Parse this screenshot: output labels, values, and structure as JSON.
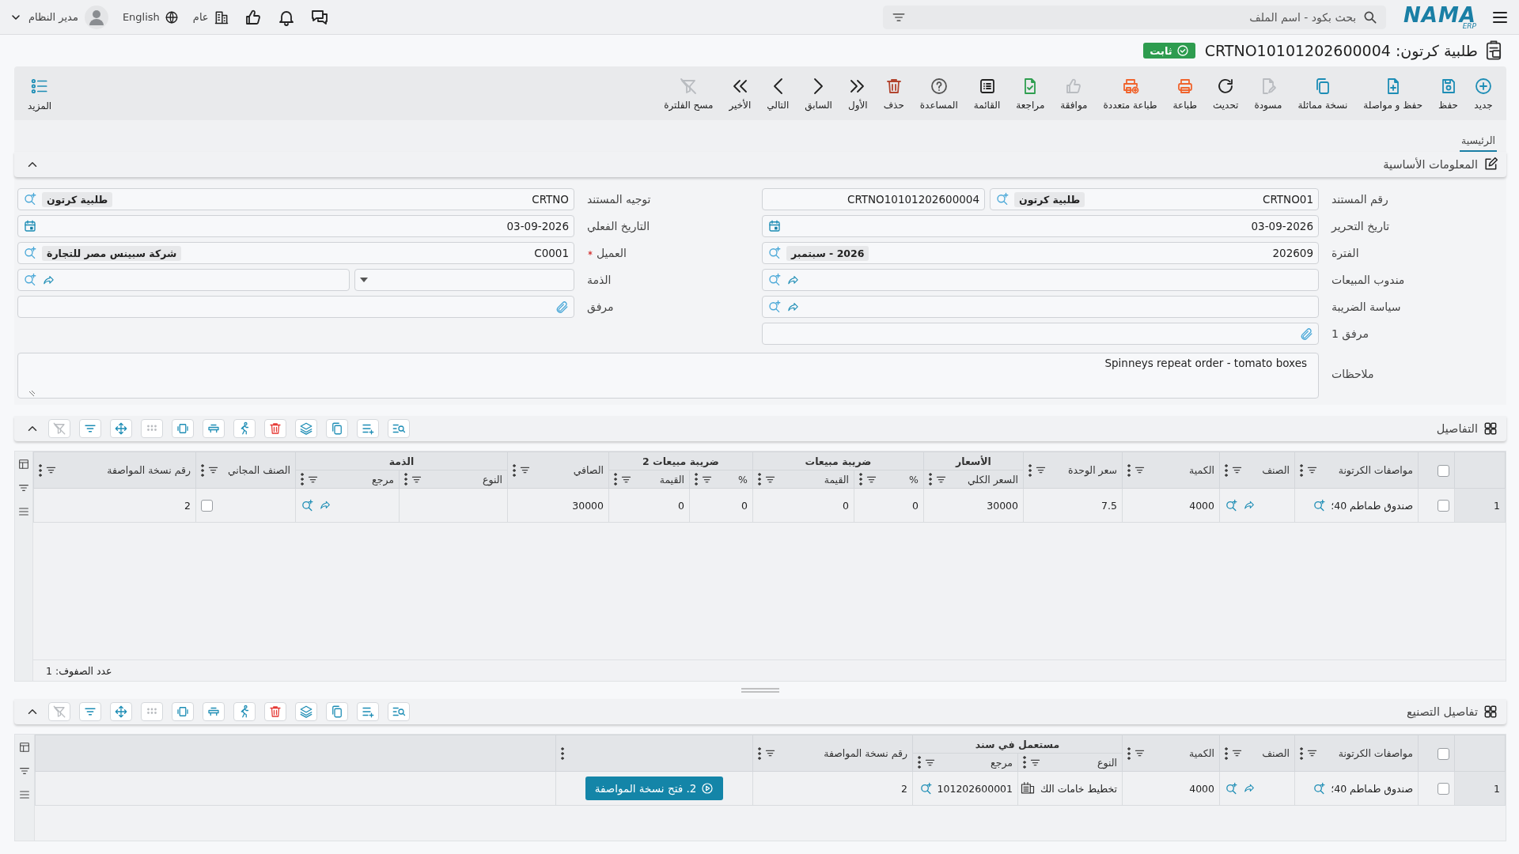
{
  "topbar": {
    "logo": "NAMA",
    "logo_sub": "ERP",
    "search": {
      "placeholder": "بحث بكود - اسم الملف"
    },
    "company": "عام",
    "language": "English",
    "user": "مدير النظام"
  },
  "title": {
    "text": "طلبية كرتون: CRTNO10101202600004",
    "status": "ثابت"
  },
  "toolbar": [
    {
      "label": "جديد",
      "disabled": false
    },
    {
      "label": "حفظ",
      "disabled": false
    },
    {
      "label": "حفظ و مواصلة",
      "disabled": false
    },
    {
      "label": "نسخة مماثلة",
      "disabled": false
    },
    {
      "label": "مسودة",
      "disabled": true
    },
    {
      "label": "تحديث",
      "disabled": false
    },
    {
      "label": "طباعة",
      "disabled": false
    },
    {
      "label": "طباعة متعددة",
      "disabled": false
    },
    {
      "label": "موافقة",
      "disabled": true
    },
    {
      "label": "مراجعة",
      "disabled": false
    },
    {
      "label": "القائمة",
      "disabled": false
    },
    {
      "label": "المساعدة",
      "disabled": false
    },
    {
      "label": "حذف",
      "disabled": false
    },
    {
      "label": "الأول",
      "disabled": false
    },
    {
      "label": "السابق",
      "disabled": false
    },
    {
      "label": "التالي",
      "disabled": false
    },
    {
      "label": "الأخير",
      "disabled": false
    },
    {
      "label": "مسح الفلترة",
      "disabled": true
    }
  ],
  "more": "المزيد",
  "tabs": [
    {
      "label": "الرئيسية",
      "selected": true
    }
  ],
  "basic_info": {
    "title": "المعلومات الأساسية",
    "expanded": true,
    "rows": [
      [
        {
          "label": "رقم المستند",
          "kind": "doc_number",
          "value": "CRTNO01",
          "tag": "طلبية كرتون",
          "extra": "CRTNO10101202600004",
          "required": false
        },
        {
          "label": "توجيه المستند",
          "kind": "lookup",
          "value": "CRTNO",
          "tag": "طلبية كرتون",
          "required": false
        }
      ],
      [
        {
          "label": "تاريخ التحرير",
          "kind": "date",
          "value": "03-09-2026",
          "required": false
        },
        {
          "label": "التاريخ الفعلي",
          "kind": "date",
          "value": "03-09-2026",
          "required": false
        }
      ],
      [
        {
          "label": "الفترة",
          "kind": "lookup",
          "value": "202609",
          "tag": "2026 - سبتمبر",
          "required": false
        },
        {
          "label": "العميل",
          "kind": "lookup",
          "value": "C0001",
          "tag": "شركة سبينس مصر للتجارة",
          "required": true
        }
      ],
      [
        {
          "label": "مندوب المبيعات",
          "kind": "link",
          "required": false
        },
        {
          "label": "الذمة",
          "kind": "combo",
          "required": false
        }
      ],
      [
        {
          "label": "سياسة الضريبة",
          "kind": "link",
          "required": false
        },
        {
          "label": "مرفق",
          "kind": "attach",
          "required": false
        }
      ],
      [
        {
          "label": "مرفق 1",
          "kind": "attach",
          "required": false
        }
      ]
    ],
    "notes": {
      "label": "ملاحظات",
      "value": "Spinneys repeat order - tomato boxes"
    }
  },
  "details": {
    "title": "التفاصيل",
    "expanded": true,
    "tools": [
      {
        "disabled": false
      },
      {
        "disabled": false
      },
      {
        "disabled": false
      },
      {
        "disabled": false
      },
      {
        "disabled": false
      },
      {
        "disabled": false
      },
      {
        "disabled": false
      },
      {
        "disabled": false
      },
      {
        "disabled": true
      },
      {
        "disabled": false
      },
      {
        "disabled": false
      },
      {
        "disabled": true
      }
    ],
    "all_selected": false,
    "columns": [
      {
        "label": "مواصفات الكرتونة"
      },
      {
        "label": "الصنف"
      },
      {
        "label": "الكمية"
      },
      {
        "label": "سعر الوحدة"
      },
      {
        "label": "الأسعار",
        "children": [
          {
            "label": "السعر الكلي"
          }
        ]
      },
      {
        "label": "ضريبة مبيعات",
        "colspan": 2,
        "children": [
          {
            "label": "%"
          },
          {
            "label": "القيمة"
          }
        ]
      },
      {
        "label": "ضريبة مبيعات 2",
        "colspan": 2,
        "children": [
          {
            "label": "%"
          },
          {
            "label": "القيمة"
          }
        ]
      },
      {
        "label": "الصافي"
      },
      {
        "label": "الذمة",
        "colspan": 2,
        "children": [
          {
            "label": "النوع"
          },
          {
            "label": "مرجع"
          }
        ]
      },
      {
        "label": "الصنف المجاني"
      },
      {
        "label": "رقم نسخة المواصفة"
      }
    ],
    "rows": [
      {
        "number": "1",
        "selected": false,
        "cells": [
          {
            "kind": "lookup",
            "value": "صندوق طماطم 40؛"
          },
          {
            "kind": "link"
          },
          {
            "kind": "text",
            "value": "4000"
          },
          {
            "kind": "text",
            "value": "7.5"
          },
          {
            "kind": "text",
            "value": "30000"
          },
          {
            "kind": "text",
            "value": "0"
          },
          {
            "kind": "text",
            "value": "0"
          },
          {
            "kind": "text",
            "value": "0"
          },
          {
            "kind": "text",
            "value": "0"
          },
          {
            "kind": "text",
            "value": "30000"
          },
          {
            "kind": "empty"
          },
          {
            "kind": "link"
          },
          {
            "kind": "check",
            "checked": false
          },
          {
            "kind": "text",
            "value": "2"
          }
        ]
      }
    ],
    "row_count": "عدد الصفوف: 1"
  },
  "manufacturing": {
    "title": "تفاصيل التصنيع",
    "expanded": true,
    "tools": [
      {
        "disabled": false
      },
      {
        "disabled": false
      },
      {
        "disabled": false
      },
      {
        "disabled": false
      },
      {
        "disabled": false
      },
      {
        "disabled": false
      },
      {
        "disabled": false
      },
      {
        "disabled": false
      },
      {
        "disabled": true
      },
      {
        "disabled": false
      },
      {
        "disabled": false
      },
      {
        "disabled": true
      }
    ],
    "all_selected": false,
    "columns": [
      {
        "label": "مواصفات الكرتونة"
      },
      {
        "label": "الصنف"
      },
      {
        "label": "الكمية"
      },
      {
        "label": "مستعمل في سند",
        "colspan": 2,
        "children": [
          {
            "label": "النوع"
          },
          {
            "label": "مرجع"
          }
        ]
      },
      {
        "label": "رقم نسخة المواصفة"
      },
      {
        "filterable": false
      }
    ],
    "rows": [
      {
        "number": "1",
        "selected": false,
        "cells": [
          {
            "kind": "lookup",
            "value": "صندوق طماطم 40؛"
          },
          {
            "kind": "link"
          },
          {
            "kind": "text",
            "value": "4000"
          },
          {
            "kind": "doc",
            "value": "تخطيط خامات الك"
          },
          {
            "kind": "lookup",
            "value": "101202600001"
          },
          {
            "kind": "text",
            "value": "2"
          },
          {
            "kind": "button",
            "value": "2. فتح نسخة المواصفة"
          }
        ]
      }
    ]
  }
}
